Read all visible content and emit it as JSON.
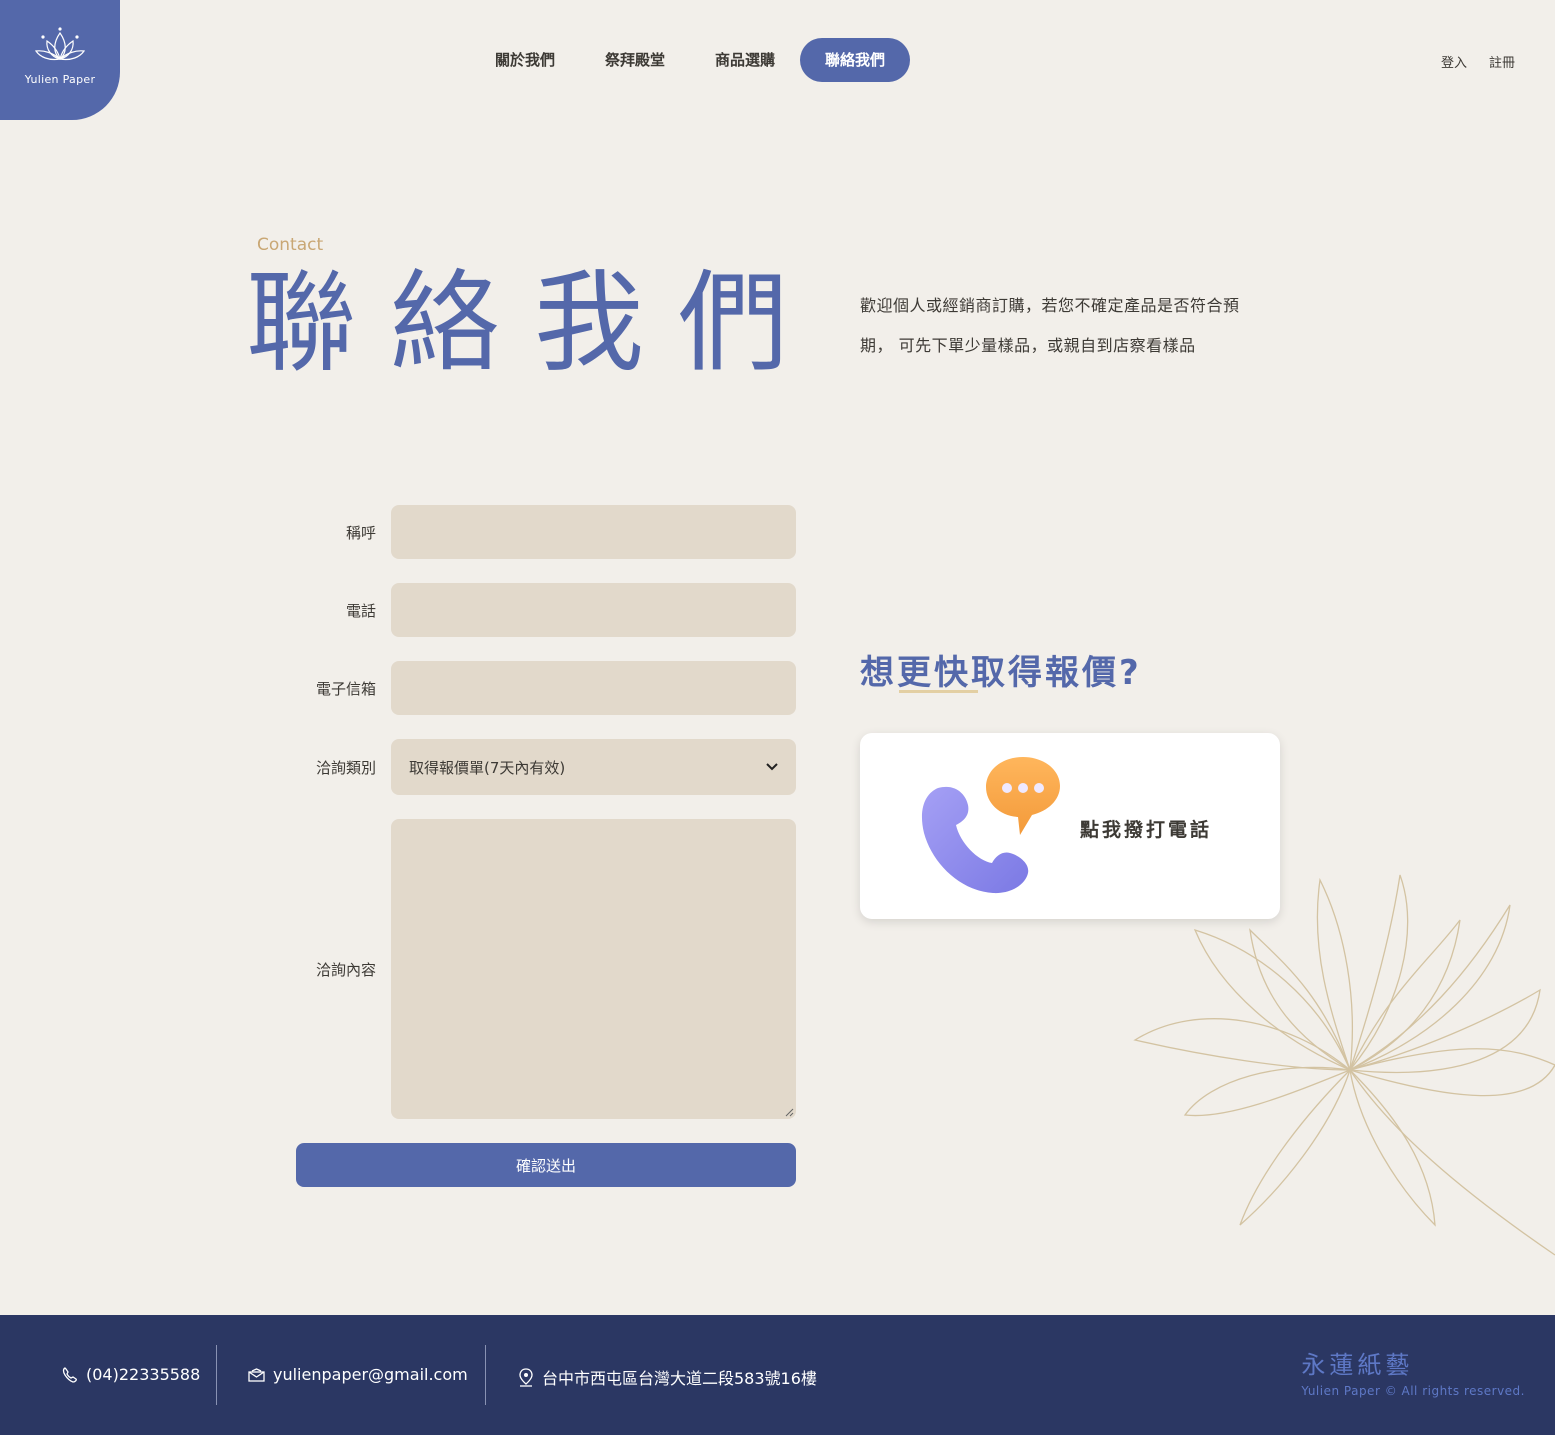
{
  "brand": {
    "logo_text": "Yulien Paper"
  },
  "nav": {
    "items": [
      {
        "label": "關於我們"
      },
      {
        "label": "祭拜殿堂"
      },
      {
        "label": "商品選購"
      },
      {
        "label": "聯絡我們"
      }
    ],
    "active_index": 3
  },
  "auth": {
    "login": "登入",
    "register": "註冊"
  },
  "hero": {
    "eyebrow": "Contact",
    "title": "聯絡我們",
    "intro_line1": "歡迎個人或經銷商訂購，若您不確定產品是否符合預",
    "intro_line2": "期， 可先下單少量樣品，或親自到店察看樣品"
  },
  "form": {
    "name_label": "稱呼",
    "phone_label": "電話",
    "email_label": "電子信箱",
    "type_label": "洽詢類別",
    "type_selected": "取得報價單(7天內有效)",
    "content_label": "洽詢內容",
    "submit_label": "確認送出"
  },
  "quote": {
    "heading": "想更快取得報價?",
    "call_label": "點我撥打電話"
  },
  "footer": {
    "phone": "(04)22335588",
    "email": "yulienpaper@gmail.com",
    "address": "台中市西屯區台灣大道二段583號16樓",
    "brand_cn": "永蓮紙藝",
    "copyright": "Yulien Paper © All rights reserved."
  },
  "colors": {
    "primary": "#5468aa",
    "background": "#f2efea",
    "field": "#e2d9cb",
    "footer": "#2b3763",
    "accent": "#c9a774"
  }
}
